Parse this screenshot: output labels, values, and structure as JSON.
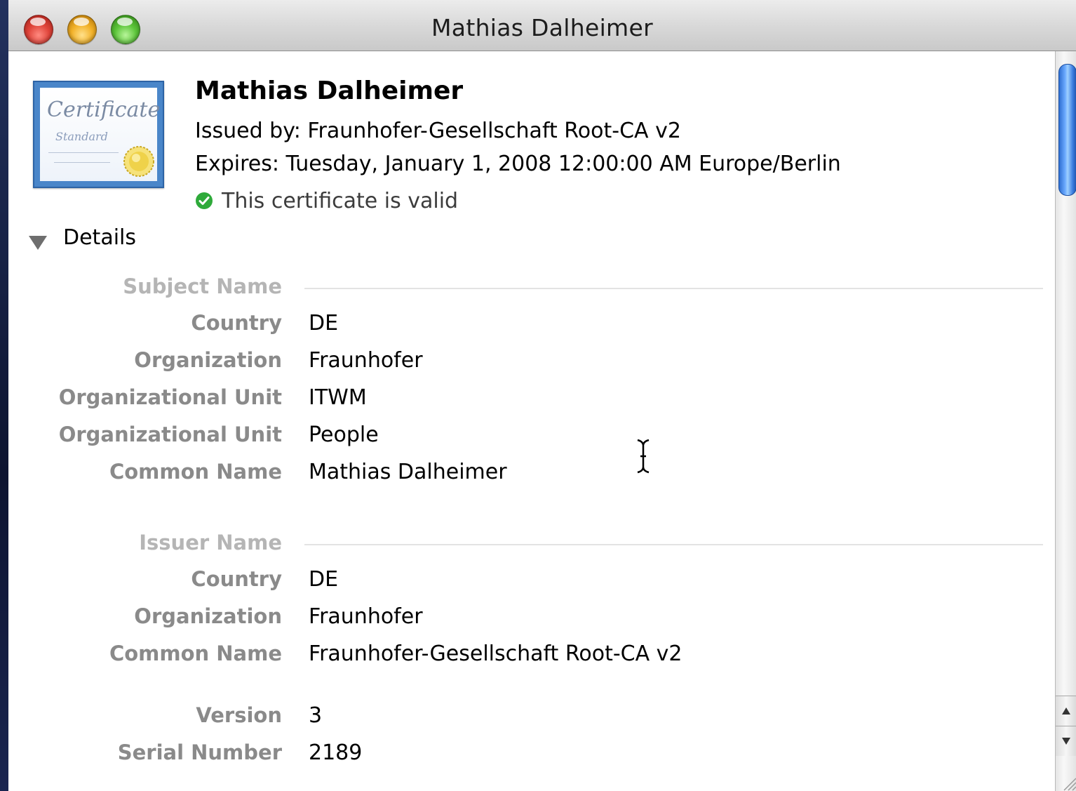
{
  "window": {
    "title": "Mathias Dalheimer"
  },
  "header": {
    "name": "Mathias Dalheimer",
    "issued_by": "Issued by: Fraunhofer-Gesellschaft Root-CA v2",
    "expires": "Expires: Tuesday, January 1, 2008 12:00:00 AM Europe/Berlin",
    "status": "This certificate is valid",
    "status_color": "#2eaa3a",
    "icon": {
      "name": "certificate-icon",
      "title": "Certificate",
      "subtitle": "Standard"
    }
  },
  "details": {
    "label": "Details",
    "expanded": true,
    "subject": {
      "heading": "Subject Name",
      "rows": [
        {
          "label": "Country",
          "value": "DE"
        },
        {
          "label": "Organization",
          "value": "Fraunhofer"
        },
        {
          "label": "Organizational Unit",
          "value": "ITWM"
        },
        {
          "label": "Organizational Unit",
          "value": "People"
        },
        {
          "label": "Common Name",
          "value": "Mathias Dalheimer"
        }
      ]
    },
    "issuer": {
      "heading": "Issuer Name",
      "rows": [
        {
          "label": "Country",
          "value": "DE"
        },
        {
          "label": "Organization",
          "value": "Fraunhofer"
        },
        {
          "label": "Common Name",
          "value": "Fraunhofer-Gesellschaft Root-CA v2"
        }
      ]
    },
    "misc": {
      "rows": [
        {
          "label": "Version",
          "value": "3"
        },
        {
          "label": "Serial Number",
          "value": "2189"
        }
      ]
    }
  },
  "scrollbar": {
    "accent": "#3d7fe0"
  }
}
